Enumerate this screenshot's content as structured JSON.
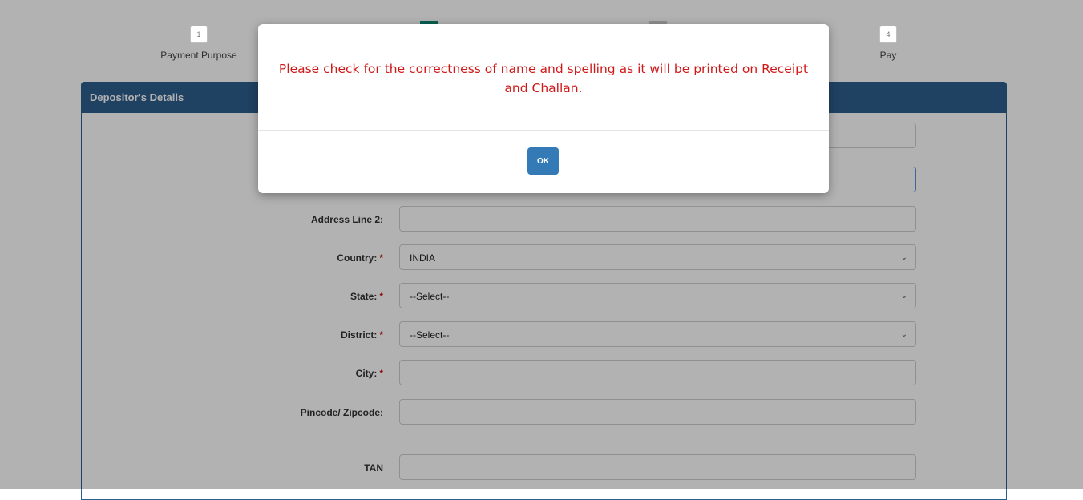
{
  "stepper": {
    "steps": [
      {
        "number": "1",
        "label": "Payment Purpose"
      },
      {
        "number": "4",
        "label": "Pay"
      }
    ]
  },
  "panel": {
    "title": "Depositor's Details"
  },
  "form": {
    "address_line2_label": "Address Line 2:",
    "country_label": "Country:",
    "country_value": "INDIA",
    "state_label": "State:",
    "state_value": "--Select--",
    "district_label": "District:",
    "district_value": "--Select--",
    "city_label": "City:",
    "pincode_label": "Pincode/ Zipcode:",
    "tan_label": "TAN",
    "required_marker": "*",
    "dropdown_glyph": "⌄"
  },
  "modal": {
    "message": "Please check for the correctness of name and spelling as it will be printed on Receipt and Challan.",
    "ok_label": "OK"
  },
  "colors": {
    "panel_header": "#2d5f8e",
    "alert_text": "#d01818",
    "ok_button": "#337ab7",
    "step_accent": "#0e8c77"
  }
}
